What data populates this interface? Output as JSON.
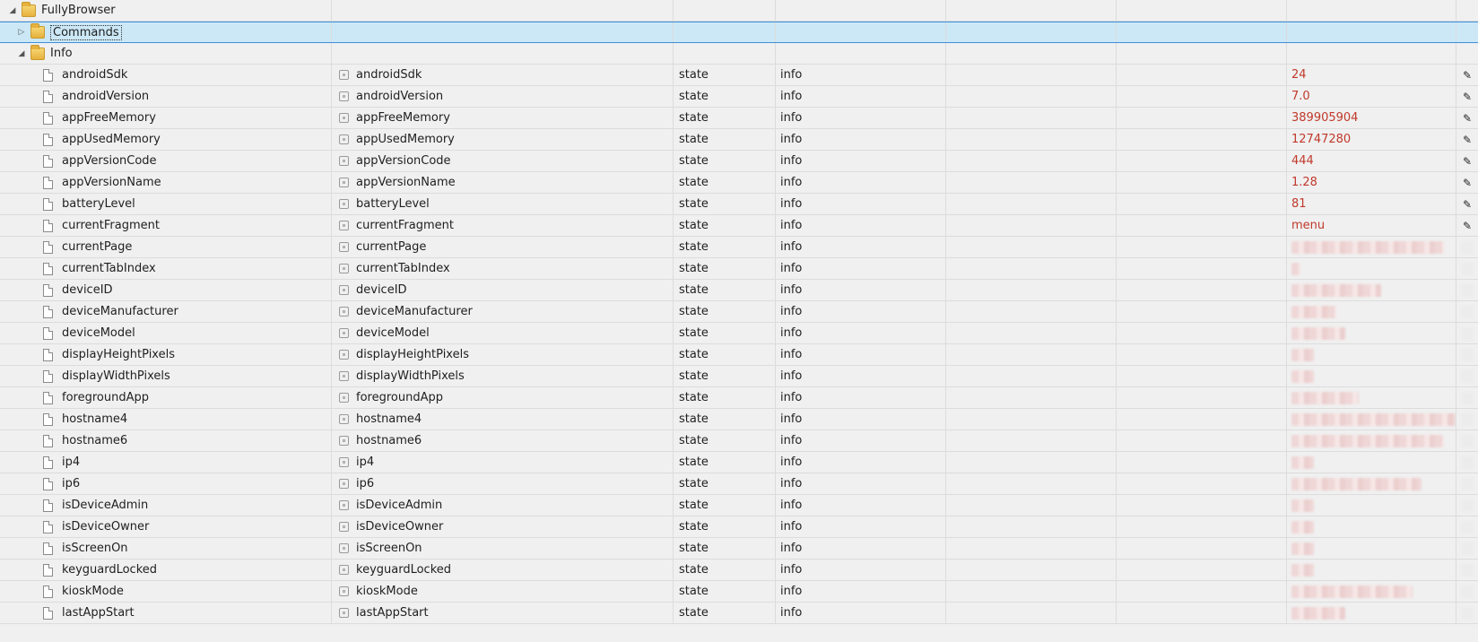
{
  "tree": {
    "root": {
      "label": "FullyBrowser"
    },
    "commands": {
      "label": "Commands"
    },
    "info": {
      "label": "Info"
    },
    "rows": [
      {
        "name": "androidSdk",
        "id": "androidSdk",
        "type": "state",
        "role": "info",
        "value": "24"
      },
      {
        "name": "androidVersion",
        "id": "androidVersion",
        "type": "state",
        "role": "info",
        "value": "7.0"
      },
      {
        "name": "appFreeMemory",
        "id": "appFreeMemory",
        "type": "state",
        "role": "info",
        "value": "389905904"
      },
      {
        "name": "appUsedMemory",
        "id": "appUsedMemory",
        "type": "state",
        "role": "info",
        "value": "12747280"
      },
      {
        "name": "appVersionCode",
        "id": "appVersionCode",
        "type": "state",
        "role": "info",
        "value": "444"
      },
      {
        "name": "appVersionName",
        "id": "appVersionName",
        "type": "state",
        "role": "info",
        "value": "1.28"
      },
      {
        "name": "batteryLevel",
        "id": "batteryLevel",
        "type": "state",
        "role": "info",
        "value": "81"
      },
      {
        "name": "currentFragment",
        "id": "currentFragment",
        "type": "state",
        "role": "info",
        "value": "menu"
      },
      {
        "name": "currentPage",
        "id": "currentPage",
        "type": "state",
        "role": "info",
        "value": ""
      },
      {
        "name": "currentTabIndex",
        "id": "currentTabIndex",
        "type": "state",
        "role": "info",
        "value": ""
      },
      {
        "name": "deviceID",
        "id": "deviceID",
        "type": "state",
        "role": "info",
        "value": ""
      },
      {
        "name": "deviceManufacturer",
        "id": "deviceManufacturer",
        "type": "state",
        "role": "info",
        "value": ""
      },
      {
        "name": "deviceModel",
        "id": "deviceModel",
        "type": "state",
        "role": "info",
        "value": ""
      },
      {
        "name": "displayHeightPixels",
        "id": "displayHeightPixels",
        "type": "state",
        "role": "info",
        "value": ""
      },
      {
        "name": "displayWidthPixels",
        "id": "displayWidthPixels",
        "type": "state",
        "role": "info",
        "value": ""
      },
      {
        "name": "foregroundApp",
        "id": "foregroundApp",
        "type": "state",
        "role": "info",
        "value": ""
      },
      {
        "name": "hostname4",
        "id": "hostname4",
        "type": "state",
        "role": "info",
        "value": ""
      },
      {
        "name": "hostname6",
        "id": "hostname6",
        "type": "state",
        "role": "info",
        "value": ""
      },
      {
        "name": "ip4",
        "id": "ip4",
        "type": "state",
        "role": "info",
        "value": ""
      },
      {
        "name": "ip6",
        "id": "ip6",
        "type": "state",
        "role": "info",
        "value": ""
      },
      {
        "name": "isDeviceAdmin",
        "id": "isDeviceAdmin",
        "type": "state",
        "role": "info",
        "value": ""
      },
      {
        "name": "isDeviceOwner",
        "id": "isDeviceOwner",
        "type": "state",
        "role": "info",
        "value": ""
      },
      {
        "name": "isScreenOn",
        "id": "isScreenOn",
        "type": "state",
        "role": "info",
        "value": ""
      },
      {
        "name": "keyguardLocked",
        "id": "keyguardLocked",
        "type": "state",
        "role": "info",
        "value": ""
      },
      {
        "name": "kioskMode",
        "id": "kioskMode",
        "type": "state",
        "role": "info",
        "value": ""
      },
      {
        "name": "lastAppStart",
        "id": "lastAppStart",
        "type": "state",
        "role": "info",
        "value": ""
      }
    ]
  },
  "colors": {
    "value_text": "#c0392b",
    "selection": "#cce8f7",
    "selection_border": "#3c8fd8"
  },
  "icons": {
    "folder": "folder-icon",
    "file": "file-icon",
    "state": "state-icon",
    "edit": "pencil-icon"
  }
}
